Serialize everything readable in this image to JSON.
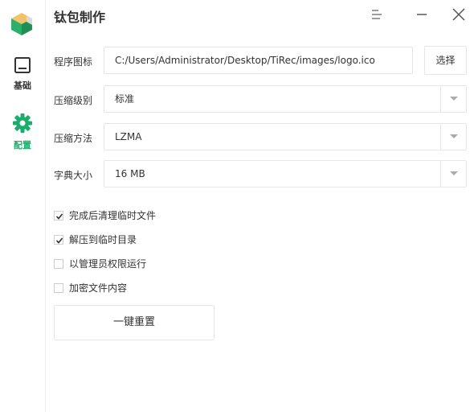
{
  "app": {
    "title": "钛包制作"
  },
  "sidebar": {
    "items": [
      {
        "label": "基础",
        "icon": "monitor-icon"
      },
      {
        "label": "配置",
        "icon": "gear-icon",
        "color": "#1aad6b"
      }
    ]
  },
  "form": {
    "icon_label": "程序图标",
    "icon_path": "C:/Users/Administrator/Desktop/TiRec/images/logo.ico",
    "choose_label": "选择",
    "compress_level_label": "压缩级别",
    "compress_level_value": "标准",
    "compress_method_label": "压缩方法",
    "compress_method_value": "LZMA",
    "dict_size_label": "字典大小",
    "dict_size_value": "16 MB"
  },
  "options": [
    {
      "label": "完成后清理临时文件",
      "checked": true
    },
    {
      "label": "解压到临时目录",
      "checked": true
    },
    {
      "label": "以管理员权限运行",
      "checked": false
    },
    {
      "label": "加密文件内容",
      "checked": false
    }
  ],
  "reset_label": "一键重置",
  "colors": {
    "accent": "#1aad6b",
    "text": "#333333",
    "border": "#e6e6e6"
  }
}
